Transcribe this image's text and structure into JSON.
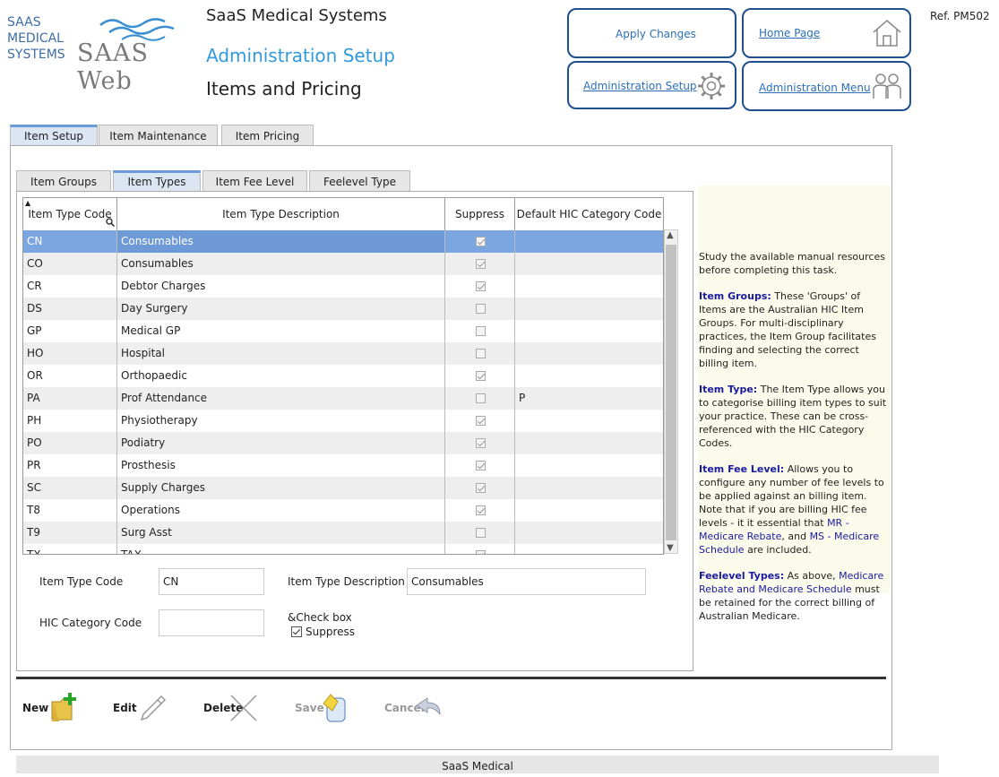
{
  "logo": {
    "line1": "SAAS",
    "line2": "MEDICAL",
    "line3": "SYSTEMS",
    "brand": "SAAS Web"
  },
  "header": {
    "company": "SaaS Medical Systems",
    "subtitle": "Administration Setup",
    "page_title": "Items and Pricing",
    "ref": "Ref. PM502"
  },
  "nav": {
    "apply_changes": "Apply Changes",
    "home_page": "Home Page",
    "administration_setup": "Administration Setup",
    "administration_menu": "Administration Menu"
  },
  "tabs": {
    "item_setup": "Item Setup",
    "item_maintenance": "Item Maintenance",
    "item_pricing": "Item Pricing"
  },
  "subtabs": {
    "item_groups": "Item Groups",
    "item_types": "Item Types",
    "item_fee_level": "Item Fee Level",
    "feelevel_type": "Feelevel Type"
  },
  "grid": {
    "columns": {
      "code": "Item Type Code",
      "description": "Item Type Description",
      "suppress": "Suppress",
      "hic": "Default HIC Category Code"
    },
    "rows": [
      {
        "code": "CN",
        "description": "Consumables",
        "suppress": true,
        "hic": "",
        "selected": true
      },
      {
        "code": "CO",
        "description": "Consumables",
        "suppress": true,
        "hic": ""
      },
      {
        "code": "CR",
        "description": "Debtor Charges",
        "suppress": true,
        "hic": ""
      },
      {
        "code": "DS",
        "description": "Day Surgery",
        "suppress": false,
        "hic": ""
      },
      {
        "code": "GP",
        "description": "Medical GP",
        "suppress": false,
        "hic": ""
      },
      {
        "code": "HO",
        "description": "Hospital",
        "suppress": false,
        "hic": ""
      },
      {
        "code": "OR",
        "description": "Orthopaedic",
        "suppress": true,
        "hic": ""
      },
      {
        "code": "PA",
        "description": "Prof Attendance",
        "suppress": false,
        "hic": "P"
      },
      {
        "code": "PH",
        "description": "Physiotherapy",
        "suppress": true,
        "hic": ""
      },
      {
        "code": "PO",
        "description": "Podiatry",
        "suppress": true,
        "hic": ""
      },
      {
        "code": "PR",
        "description": "Prosthesis",
        "suppress": true,
        "hic": ""
      },
      {
        "code": "SC",
        "description": "Supply Charges",
        "suppress": true,
        "hic": ""
      },
      {
        "code": "T8",
        "description": "Operations",
        "suppress": true,
        "hic": ""
      },
      {
        "code": "T9",
        "description": "Surg Asst",
        "suppress": false,
        "hic": ""
      },
      {
        "code": "TX",
        "description": "TAX",
        "suppress": true,
        "hic": ""
      }
    ]
  },
  "form": {
    "code_label": "Item Type Code",
    "code_value": "CN",
    "desc_label": "Item Type Description",
    "desc_value": "Consumables",
    "hic_label": "HIC Category Code",
    "hic_value": "",
    "check_caption": "&Check box",
    "suppress_label": "Suppress",
    "suppress_checked": true
  },
  "info": {
    "intro": "Study the available manual resources before completing this task.",
    "groups_title": "Item Groups:",
    "groups_text": "These 'Groups' of Items are the Australian HIC Item Groups. For multi-disciplinary practices, the Item Group facilitates finding and selecting the correct billing item.",
    "type_title": "Item Type:",
    "type_text": "The Item Type allows you to categorise billing item types to suit your practice. These can be cross-referenced with the HIC Category Codes.",
    "fee_title": "Item Fee Level:",
    "fee_text1": "Allows you to configure any number of fee levels to be applied against an billing item. Note that if you are billing HIC fee levels - it it essential that",
    "fee_link1": "MR - Medicare Rebate",
    "fee_text2": ", and",
    "fee_link2": "MS - Medicare Schedule",
    "fee_text3": "are included.",
    "types_title": "Feelevel Types:",
    "types_text1": "As above,",
    "types_link": "Medicare Rebate and Medicare Schedule",
    "types_text2": "must be retained for the correct billing of Australian Medicare."
  },
  "toolbar": {
    "new": "New",
    "edit": "Edit",
    "delete": "Delete",
    "save": "Save",
    "cancel": "Cancel"
  },
  "footer": "SaaS Medical",
  "colors": {
    "accent": "#1e4f8f",
    "selected_row": "#7ba6e0",
    "link": "#1a1aa0",
    "subtitle": "#3399dd"
  }
}
